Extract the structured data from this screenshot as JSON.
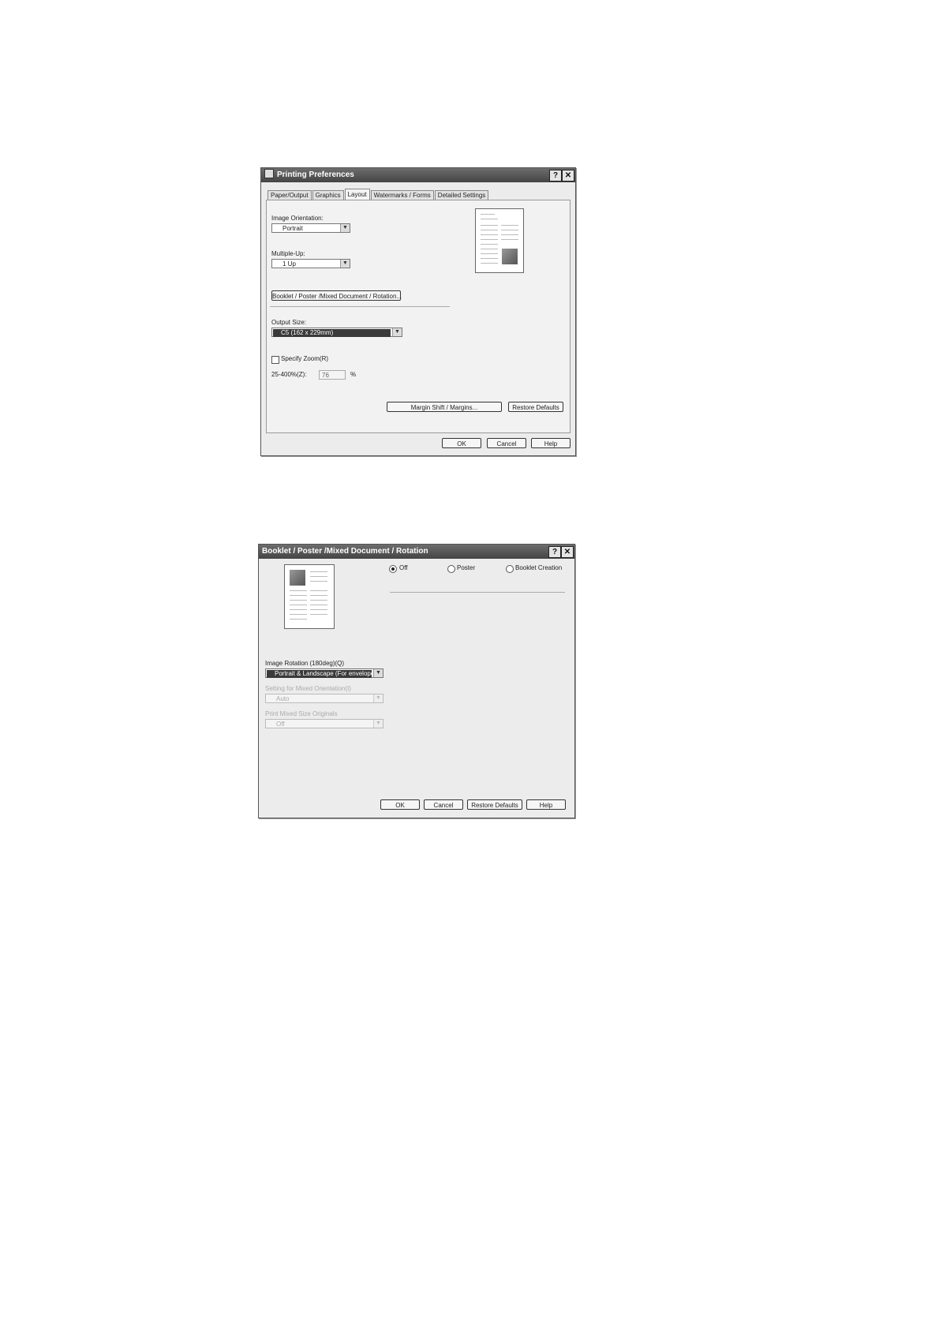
{
  "dialog1": {
    "title": "Printing Preferences",
    "help_btn": "?",
    "close_btn": "✕",
    "tabs": [
      "Paper/Output",
      "Graphics",
      "Layout",
      "Watermarks / Forms",
      "Detailed Settings"
    ],
    "active_tab": "Layout",
    "image_orientation_label": "Image Orientation:",
    "image_orientation_value": "Portrait",
    "multiple_up_label": "Multiple-Up:",
    "multiple_up_value": "1 Up",
    "booklet_button": "Booklet / Poster /Mixed Document / Rotation...",
    "output_size_label": "Output Size:",
    "output_size_value": "C5 (162 x 229mm)",
    "specify_zoom_label": "Specify Zoom(R)",
    "zoom_range_label": "25-400%(Z):",
    "zoom_value": "76",
    "zoom_unit": "%",
    "margin_button": "Margin Shift / Margins...",
    "restore_defaults": "Restore Defaults",
    "ok": "OK",
    "cancel": "Cancel",
    "help": "Help"
  },
  "dialog2": {
    "title": "Booklet / Poster /Mixed Document / Rotation",
    "help_btn": "?",
    "close_btn": "✕",
    "radio_off": "Off",
    "radio_poster": "Poster",
    "radio_booklet": "Booklet Creation",
    "image_rotation_label": "Image Rotation (180deg)(Q)",
    "image_rotation_value": "Portrait & Landscape (For envelopes)",
    "mixed_orientation_label": "Setting for Mixed Orientation(I)",
    "mixed_orientation_value": "Auto",
    "mixed_size_label": "Print Mixed Size Originals",
    "mixed_size_value": "Off",
    "ok": "OK",
    "cancel": "Cancel",
    "restore_defaults": "Restore Defaults",
    "help": "Help"
  }
}
